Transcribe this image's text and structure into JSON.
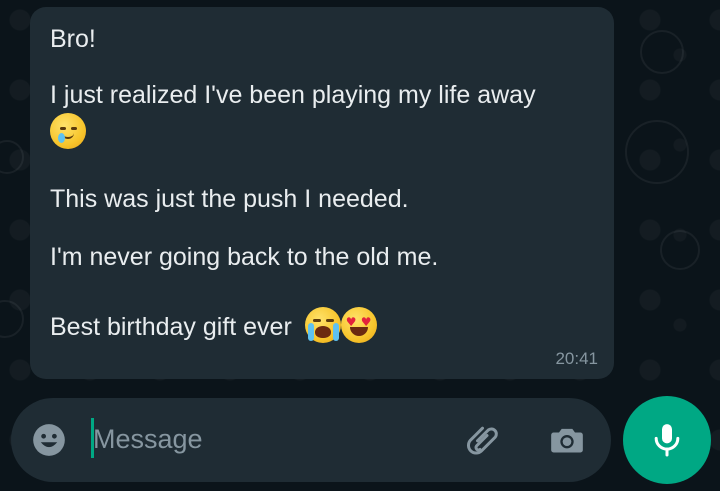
{
  "chat": {
    "message": {
      "lines": [
        "Bro!",
        "I just realized I've been playing my life away",
        "This was just the push I needed.",
        "I'm never going back to the old me.",
        "Best birthday gift ever"
      ],
      "emojis": {
        "line2": [
          "face-holding-back-tears"
        ],
        "line5": [
          "loudly-crying-face",
          "smiling-face-with-heart-eyes"
        ]
      },
      "time": "20:41"
    }
  },
  "composer": {
    "placeholder": "Message",
    "icons": {
      "emoji": "smiley-icon",
      "attach": "paperclip-icon",
      "camera": "camera-icon",
      "mic": "microphone-icon"
    }
  },
  "colors": {
    "background": "#0b141a",
    "bubble": "#1f2c34",
    "text": "#e9edef",
    "muted": "#8696a0",
    "accent": "#00a884"
  }
}
